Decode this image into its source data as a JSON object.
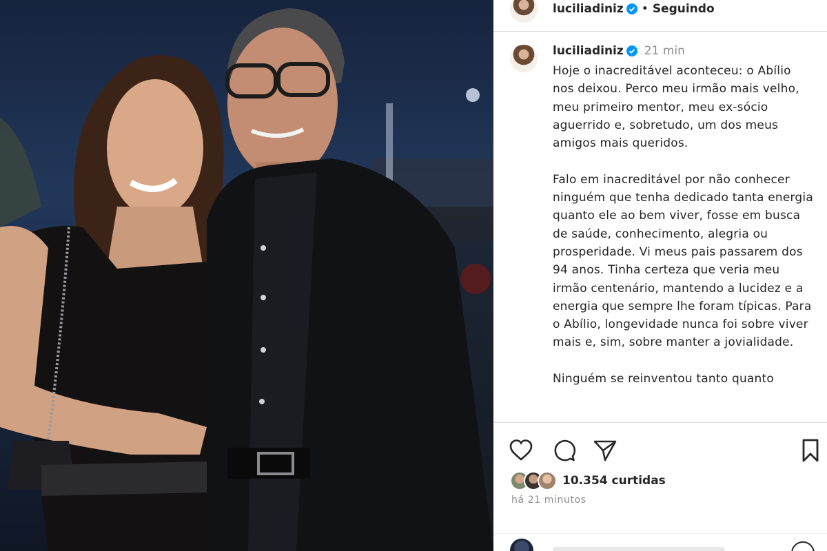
{
  "post": {
    "username": "luciliadiniz",
    "follow_status": "Seguindo",
    "caption_time": "21 min",
    "caption_paragraphs": [
      "Hoje o inacreditável aconteceu: o Abílio nos deixou. Perco meu irmão mais velho, meu primeiro mentor, meu ex-sócio aguerrido e, sobretudo, um dos meus amigos mais queridos.",
      "Falo em inacreditável por não conhecer ninguém que tenha dedicado tanta energia quanto ele ao bem viver, fosse em busca de saúde, conhecimento, alegria ou prosperidade. Vi meus pais passarem dos 94 anos. Tinha certeza que veria meu irmão centenário, mantendo a lucidez e a energia que sempre lhe foram típicas. Para o Abílio, longevidade nunca foi sobre viver mais e, sim, sobre manter a jovialidade.",
      "Ninguém se reinventou tanto quanto"
    ],
    "likes": "10.354 curtidas",
    "posted_ago": "há 21 minutos"
  },
  "icons": {
    "verified": "verified-badge-icon",
    "like": "heart-icon",
    "comment": "comment-icon",
    "share": "paper-plane-icon",
    "save": "bookmark-icon"
  },
  "colors": {
    "verified": "#0095f6",
    "text": "#262626",
    "muted": "#8e8e8e",
    "border": "#dbdbdb"
  }
}
